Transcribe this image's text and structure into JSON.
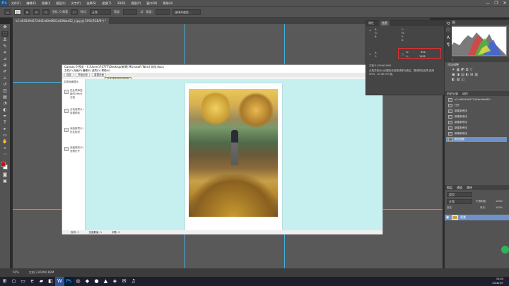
{
  "app": {
    "logo": "Ps",
    "menu": [
      "文件(F)",
      "编辑(E)",
      "图像(I)",
      "图层(L)",
      "文字(Y)",
      "选择(S)",
      "滤镜(T)",
      "3D(D)",
      "视图(V)",
      "窗口(W)",
      "帮助(H)"
    ],
    "window_controls": [
      "—",
      "❐",
      "✕"
    ]
  },
  "options_bar": {
    "feather": "羽化: 0 像素",
    "style_label": "样式:",
    "style_value": "正常",
    "width_label": "宽度:",
    "height_label": "高度:",
    "select_mask": "选择并遮住..."
  },
  "document_tab": {
    "title": "v2-a94549d2724d5ed0e6601a50fbae52_r.jpg @ 50%(RGB/8*) *"
  },
  "word": {
    "title": "Canvas 0 预览 - C:\\Users\\74777\\Desktop\\新建 Microsoft Word 文档.docx",
    "menu": "文件(F)  页面(P)  编辑(E)  选项(O)  帮助(H)",
    "toolbar": [
      "保存",
      "开始比较",
      "重置页面"
    ],
    "tooltip": "点击此处保存当前页",
    "nav": [
      "文档页面提示",
      "在此项添加新的Office 文档",
      "分析选项(1)",
      "设置颜色",
      "添加新项(2)",
      "在此检查",
      "页面修改(3)",
      "查看打开"
    ],
    "status": [
      "页码: 1",
      "页面数量: 1",
      "字数: 0"
    ]
  },
  "info": {
    "tabs": [
      "属性",
      "信息"
    ],
    "r_label": "R:",
    "g_label": "G:",
    "b_label": "B:",
    "c_label": "C:",
    "m_label": "M:",
    "y_label": "Y:",
    "k_label": "K:",
    "x_label": "X:",
    "y2_label": "Y:",
    "w_label": "W:",
    "h_label": "H:",
    "w_value": "394",
    "h_value": "1102",
    "doc_size": "文档:3.81M/6.89M",
    "hint": "点按并拖动以创建矩形选框或移动选区。要用附加选项,使用 Shift、Alt 和 Ctrl 键。"
  },
  "panels": {
    "histogram_tab": "直方图",
    "adjust_tab": "调整",
    "adjust_title": "添加调整",
    "history_tab": "历史记录",
    "actions_tab": "动作",
    "history_file": "v2-a94549d2724d5ed0e660...",
    "history_items": [
      "打开",
      "新建参考线",
      "新建参考线",
      "新建参考线",
      "新建参考线",
      "新建参考线",
      "矩形选框"
    ],
    "layers_tabs": [
      "图层",
      "通道",
      "路径"
    ],
    "layers_kind": "类型",
    "layers_mode": "正常",
    "opacity_label": "不透明度:",
    "opacity_value": "100%",
    "lock_label": "锁定:",
    "fill_label": "填充:",
    "fill_value": "100%",
    "layer_name": "背景"
  },
  "status": {
    "zoom": "50%",
    "doc": "文档:3.81M/6.89M"
  },
  "taskbar": {
    "time": "10:40",
    "date": "2018/3/7"
  },
  "colors": {
    "foreground": "#e00000",
    "background": "#ffffff",
    "guide": "#3ec9ff",
    "wordbg": "#c6f0f0",
    "selection_box": "#e03030",
    "taskbar": "#1e1e2e"
  }
}
